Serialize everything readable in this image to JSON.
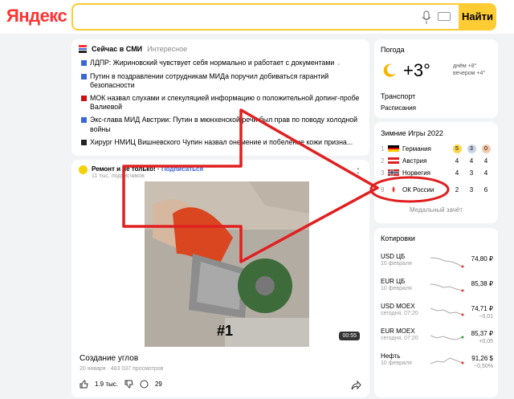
{
  "header": {
    "logo": "Яндекс",
    "search_placeholder": "",
    "search_button": "Найти"
  },
  "news": {
    "title": "Сейчас в СМИ",
    "tab": "Интересное",
    "items": [
      "ЛДПР: Жириновский чувствует себя нормально и работает с документами",
      "Путин в поздравлении сотрудникам МИДа поручил добиваться гарантий безопасности",
      "МОК назвал слухами и спекуляцией информацию о положительной допинг-пробе Валиевой",
      "Экс-глава МИД Австрии: Путин в мюнхенской речи был прав по поводу холодной войны",
      "Хирург НМИЦ Вишневского Чупин назвал онемение и побеление кожи призна..."
    ]
  },
  "video": {
    "channel": "Ремонт и не только!",
    "subscribe": "Подписаться",
    "subscribers": "11 тыс. подписчиков",
    "number_overlay": "#1",
    "duration": "00:55",
    "caption": "Создание углов",
    "date": "20 января",
    "views": "483 037 просмотров",
    "likes": "1.9 тыс.",
    "comments": "29"
  },
  "weather": {
    "title": "Погода",
    "temp": "+3°",
    "forecast_day": "днём +8°",
    "forecast_evening": "вечером +4°",
    "transport": "Транспорт",
    "schedule": "Расписания"
  },
  "olympics": {
    "title": "Зимние Игры 2022",
    "rows": [
      {
        "rank": "1",
        "country": "Германия",
        "g": "5",
        "s": "3",
        "b": "0"
      },
      {
        "rank": "2",
        "country": "Австрия",
        "g": "4",
        "s": "4",
        "b": "4"
      },
      {
        "rank": "3",
        "country": "Норвегия",
        "g": "4",
        "s": "3",
        "b": "4"
      },
      {
        "rank": "9",
        "country": "ОК России",
        "g": "2",
        "s": "3",
        "b": "6"
      }
    ],
    "footer": "Медальный зачёт"
  },
  "quotes": {
    "title": "Котировки",
    "rows": [
      {
        "name": "USD ЦБ",
        "date": "10 февраля",
        "value": "74,80 ₽",
        "change": ""
      },
      {
        "name": "EUR ЦБ",
        "date": "10 февраля",
        "value": "85,38 ₽",
        "change": ""
      },
      {
        "name": "USD MOEX",
        "date": "сегодня, 07:20",
        "value": "74,71 ₽",
        "change": "−0,01"
      },
      {
        "name": "EUR MOEX",
        "date": "сегодня, 07:20",
        "value": "85,37 ₽",
        "change": "+0,05"
      },
      {
        "name": "Нефть",
        "date": "10 февраля",
        "value": "91,26 $",
        "change": "−0,50%"
      }
    ]
  },
  "colors": {
    "accent": "#ffcc33",
    "annotation": "#e02020"
  }
}
